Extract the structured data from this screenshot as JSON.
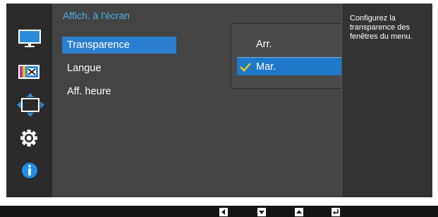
{
  "menu": {
    "title": "Affich. à l'écran",
    "items": [
      {
        "label": "Transparence",
        "selected": true
      },
      {
        "label": "Langue",
        "selected": false
      },
      {
        "label": "Aff. heure",
        "selected": false
      }
    ]
  },
  "dropdown": {
    "options": [
      {
        "label": "Arr.",
        "checked": false,
        "active": false
      },
      {
        "label": "Mar.",
        "checked": true,
        "active": true
      }
    ]
  },
  "help": {
    "text": "Configurez la transparence des fenêtres du menu."
  },
  "sidebar": {
    "icons": [
      "monitor-icon",
      "color-icon",
      "size-position-icon",
      "gear-icon",
      "info-icon"
    ],
    "active_icon": "size-position-icon"
  },
  "nav_buttons": [
    "left-arrow-icon",
    "down-arrow-icon",
    "up-arrow-icon",
    "enter-icon"
  ],
  "colors": {
    "accent_blue": "#2c7fd0",
    "title_blue": "#4fb0e6",
    "check_yellow": "#f5d000"
  }
}
